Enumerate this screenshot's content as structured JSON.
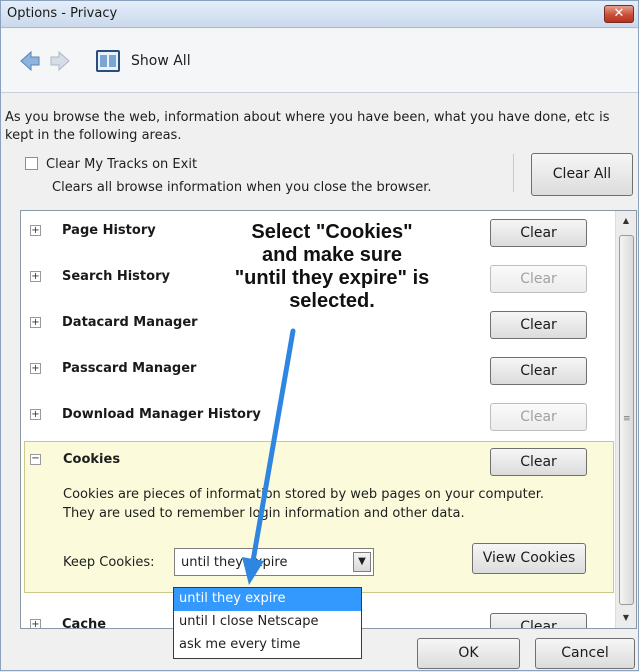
{
  "window": {
    "title": "Options - Privacy",
    "close_label": "✕"
  },
  "toolbar": {
    "show_all_label": "Show All"
  },
  "description": "As you browse the web, information about where you have been, what you have done, etc is kept in the following areas.",
  "clear_tracks": {
    "label": "Clear My Tracks on Exit",
    "checked": false,
    "sub_text": "Clears all browse information when you close the browser.",
    "clear_all_label": "Clear All"
  },
  "items": [
    {
      "label": "Page History",
      "button": "Clear",
      "enabled": true
    },
    {
      "label": "Search History",
      "button": "Clear",
      "enabled": false
    },
    {
      "label": "Datacard Manager",
      "button": "Clear",
      "enabled": true
    },
    {
      "label": "Passcard Manager",
      "button": "Clear",
      "enabled": true
    },
    {
      "label": "Download Manager History",
      "button": "Clear",
      "enabled": false
    }
  ],
  "cookies": {
    "label": "Cookies",
    "button": "Clear",
    "description_line1": "Cookies are pieces of information stored by web pages on your computer.",
    "description_line2": "They are used to remember login information and other data.",
    "keep_label": "Keep Cookies:",
    "selected_option": "until they expire",
    "view_cookies_label": "View Cookies",
    "options": [
      "until they expire",
      "until I close Netscape",
      "ask me every time"
    ]
  },
  "cache": {
    "label": "Cache",
    "button": "Clear"
  },
  "annotation": {
    "line1": "Select \"Cookies\"",
    "line2": "and make  sure",
    "line3": "\"until they expire\" is",
    "line4": "selected."
  },
  "footer": {
    "ok_label": "OK",
    "cancel_label": "Cancel"
  },
  "colors": {
    "cookies_bg": "#fbfbdc",
    "selected_option_bg": "#3399ff",
    "arrow": "#2f86e0"
  }
}
